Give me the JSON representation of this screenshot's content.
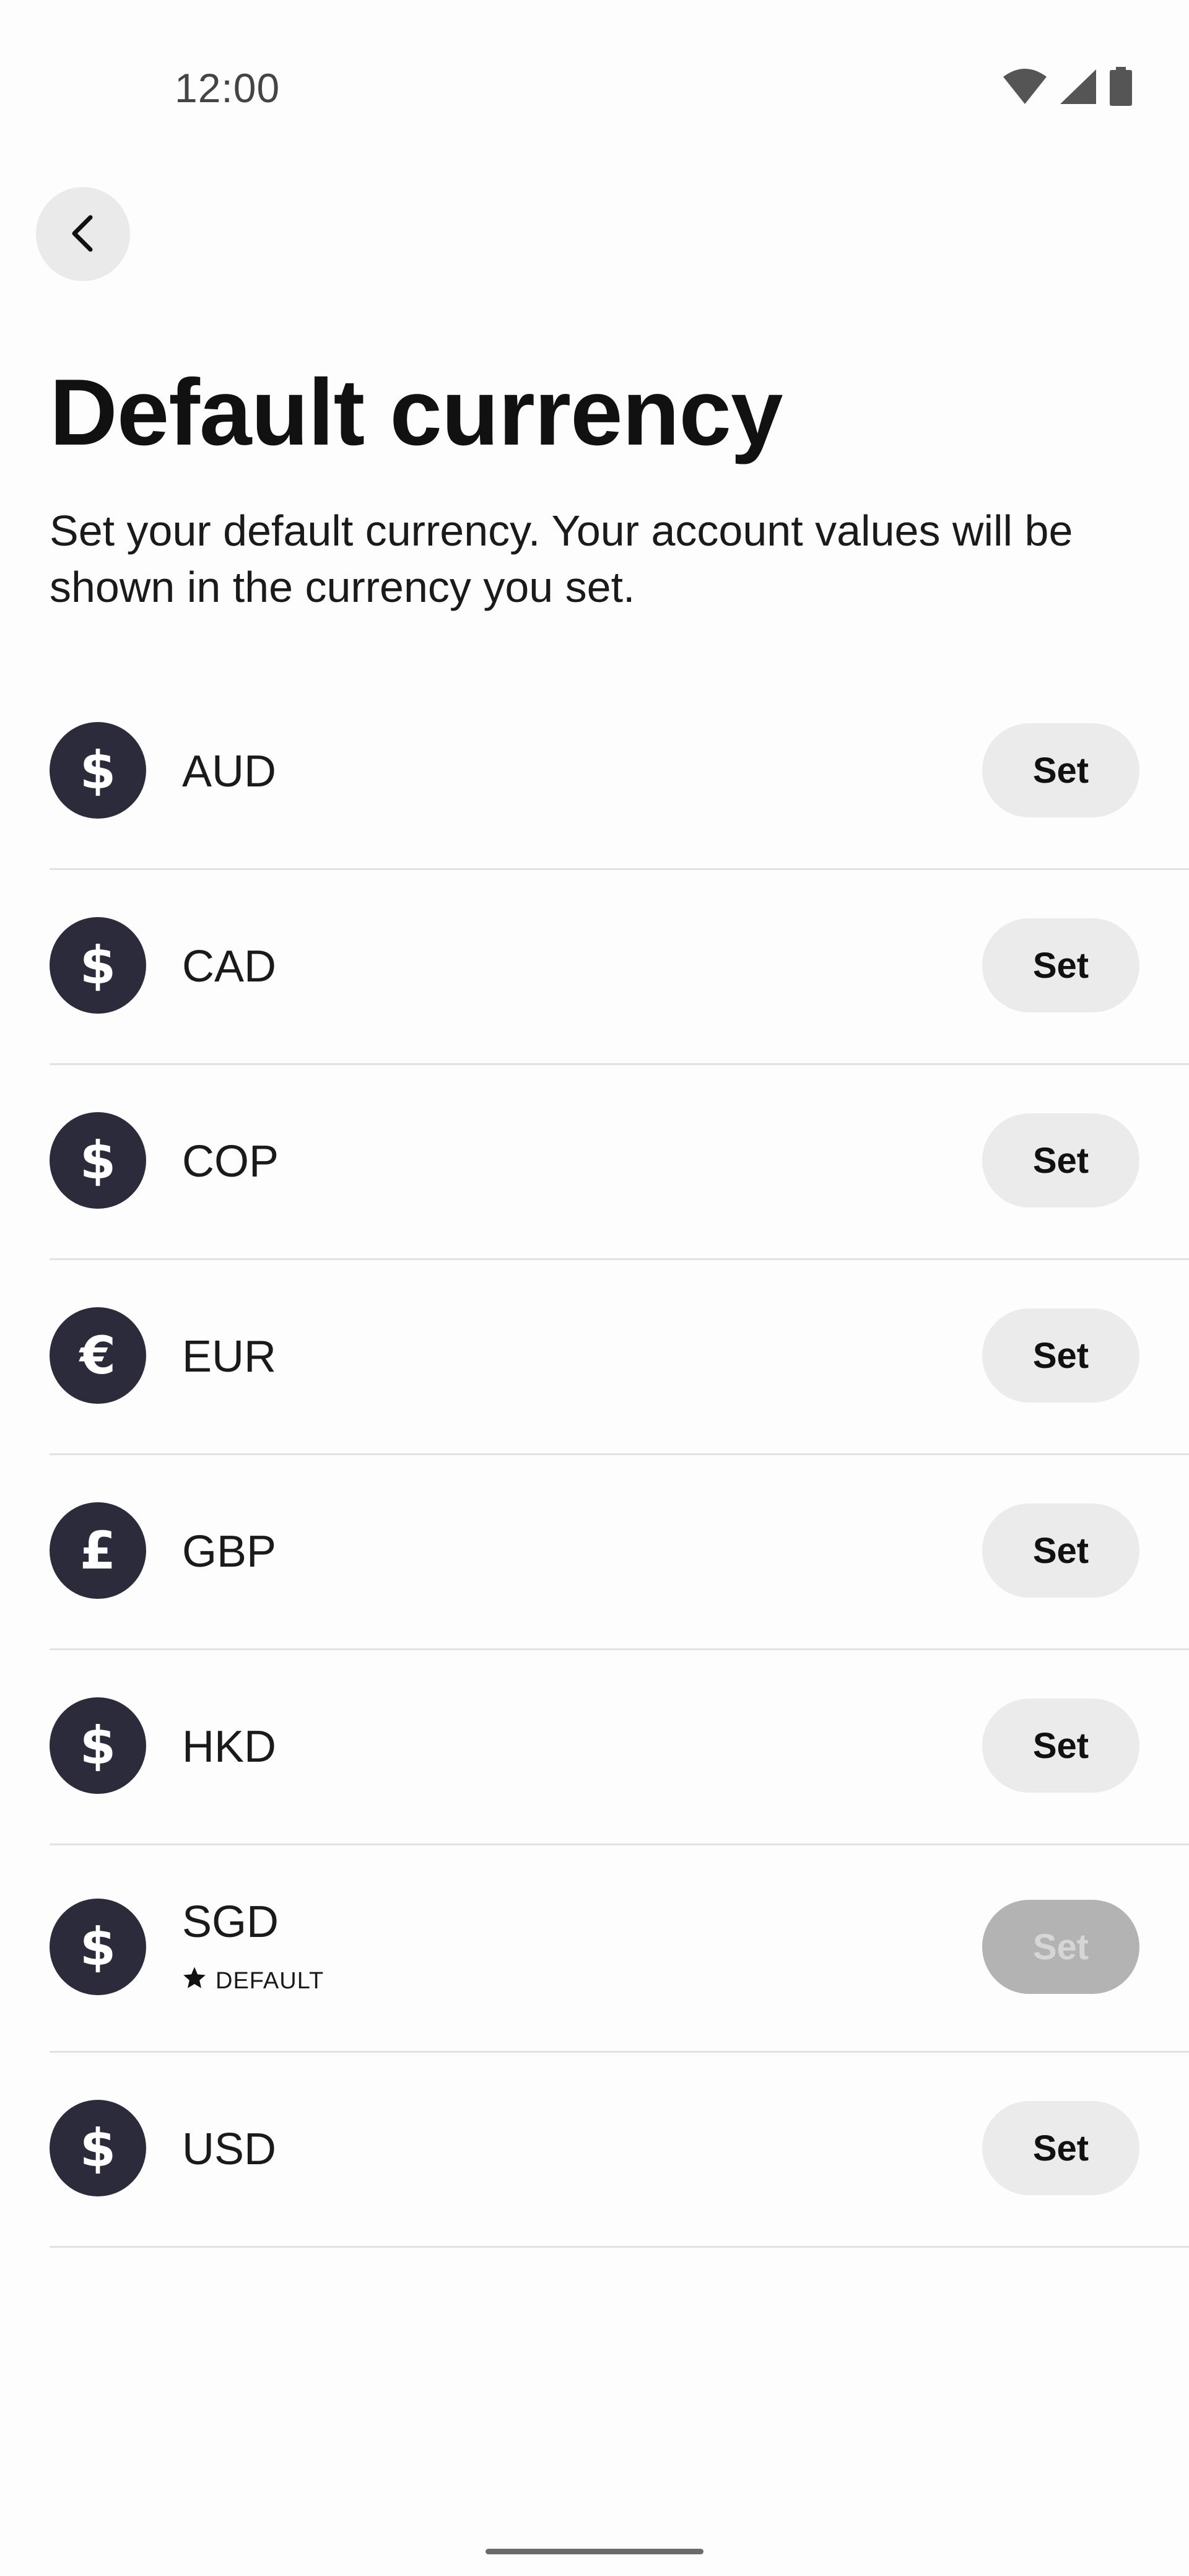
{
  "status_bar": {
    "time": "12:00",
    "icons": [
      "wifi-icon",
      "cellular-signal-icon",
      "battery-icon"
    ]
  },
  "header": {
    "back_icon": "chevron-left-icon",
    "title": "Default currency",
    "description": "Set your default currency. Your account values will be shown in the currency you set."
  },
  "currencies": [
    {
      "code": "AUD",
      "symbol": "$",
      "button_label": "Set"
    },
    {
      "code": "CAD",
      "symbol": "$",
      "button_label": "Set"
    },
    {
      "code": "COP",
      "symbol": "$",
      "button_label": "Set"
    },
    {
      "code": "EUR",
      "symbol": "€",
      "button_label": "Set"
    },
    {
      "code": "GBP",
      "symbol": "£",
      "button_label": "Set"
    },
    {
      "code": "HKD",
      "symbol": "$",
      "button_label": "Set"
    },
    {
      "code": "SGD",
      "symbol": "$",
      "button_label": "Set",
      "is_default": true,
      "default_label": "DEFAULT"
    },
    {
      "code": "USD",
      "symbol": "$",
      "button_label": "Set"
    }
  ],
  "colors": {
    "icon_background": "#2b2b3b",
    "button_background": "#ebebeb",
    "button_disabled_background": "#b3b3b3",
    "divider": "#e2e2e2"
  }
}
